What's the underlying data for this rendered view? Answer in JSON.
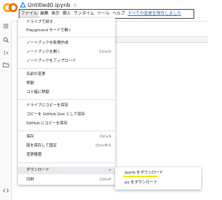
{
  "header": {
    "title": "Untitled0.ipynb",
    "star": "☆"
  },
  "menubar": {
    "items": [
      "ファイル",
      "編集",
      "表示",
      "挿入",
      "ランタイム",
      "ツール",
      "ヘルプ"
    ],
    "save_status": "すべての変更を保存しました"
  },
  "file_menu": {
    "items": [
      {
        "label": "ドライブで探す",
        "shortcut": ""
      },
      {
        "label": "Playground モードで開く",
        "shortcut": ""
      },
      {
        "label": "ノートブックを新規作成",
        "shortcut": ""
      },
      {
        "label": "ノートブックを開く",
        "shortcut": "Ctrl+O"
      },
      {
        "label": "ノートブックをアップロード",
        "shortcut": ""
      },
      {
        "label": "名前の変更",
        "shortcut": ""
      },
      {
        "label": "移動",
        "shortcut": ""
      },
      {
        "label": "ゴミ箱に移動",
        "shortcut": ""
      },
      {
        "label": "ドライブにコピーを保存",
        "shortcut": ""
      },
      {
        "label": "コピーを GitHub Gist として保存",
        "shortcut": ""
      },
      {
        "label": "GitHub にコピーを保存",
        "shortcut": ""
      },
      {
        "label": "保存",
        "shortcut": "Ctrl+S"
      },
      {
        "label": "版を保存して固定",
        "shortcut": "Ctrl+M S"
      },
      {
        "label": "変更履歴",
        "shortcut": ""
      },
      {
        "label": "ダウンロード",
        "shortcut": "▸"
      },
      {
        "label": "印刷",
        "shortcut": "Ctrl+P"
      }
    ]
  },
  "download_submenu": {
    "items": [
      ".ipynb をダウンロード",
      ".py をダウンロード"
    ]
  },
  "colors": {
    "highlight": "#f2e600",
    "link": "#1967d2",
    "logo_orange": "#f9ab00",
    "logo_amber": "#e37400"
  }
}
